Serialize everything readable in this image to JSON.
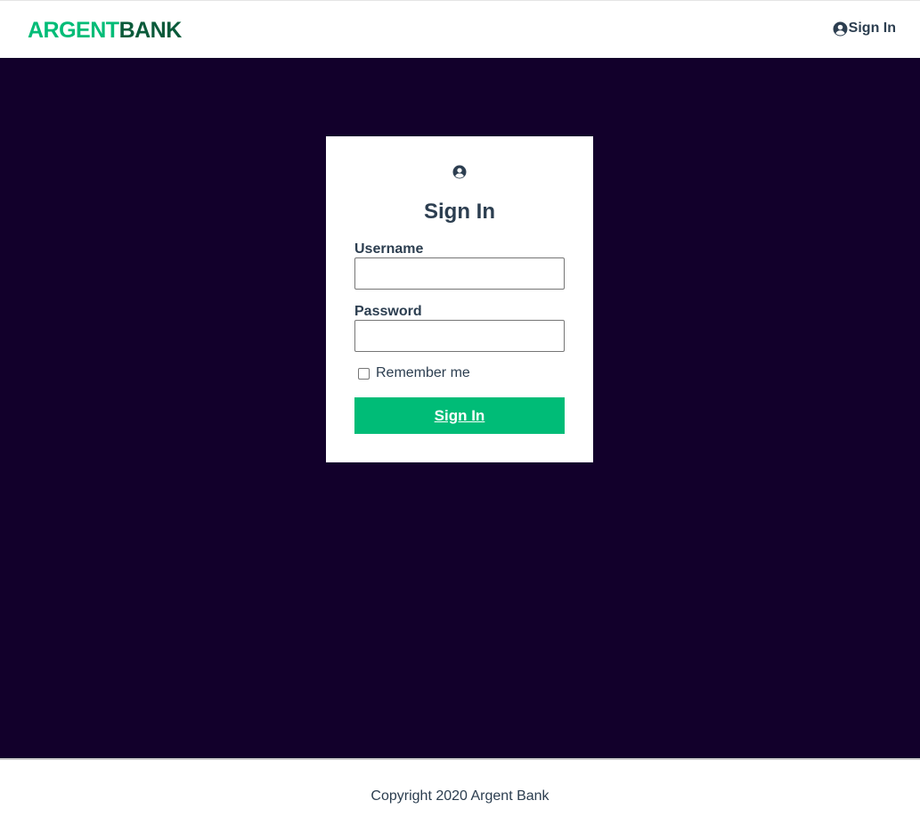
{
  "header": {
    "logo_part1": "ARGENT",
    "logo_part2": "BANK",
    "signin_label": "Sign In",
    "signin_icon": "user-circle-icon"
  },
  "login": {
    "icon": "user-circle-icon",
    "title": "Sign In",
    "username_label": "Username",
    "username_value": "",
    "password_label": "Password",
    "password_value": "",
    "remember_label": "Remember me",
    "remember_checked": false,
    "submit_label": "Sign In"
  },
  "footer": {
    "copyright": "Copyright 2020 Argent Bank"
  },
  "colors": {
    "brand_green": "#00bc77",
    "brand_dark_green": "#0a5a3a",
    "background_dark": "#12002b",
    "text": "#2c3e50"
  }
}
